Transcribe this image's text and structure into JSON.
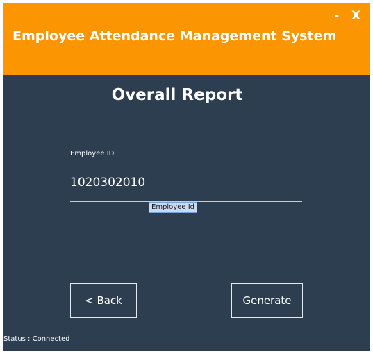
{
  "window": {
    "title": "Employee Attendance Management System",
    "minimize_label": "-",
    "close_label": "X"
  },
  "report": {
    "title": "Overall Report"
  },
  "employee_id": {
    "label": "Employee ID",
    "value": "1020302010",
    "tooltip": "Employee Id"
  },
  "buttons": {
    "back_label": "< Back",
    "generate_label": "Generate"
  },
  "status": {
    "text": "Status : Connected"
  },
  "colors": {
    "header": "#fb9502",
    "background": "#2d3e50",
    "text": "#ffffff"
  }
}
